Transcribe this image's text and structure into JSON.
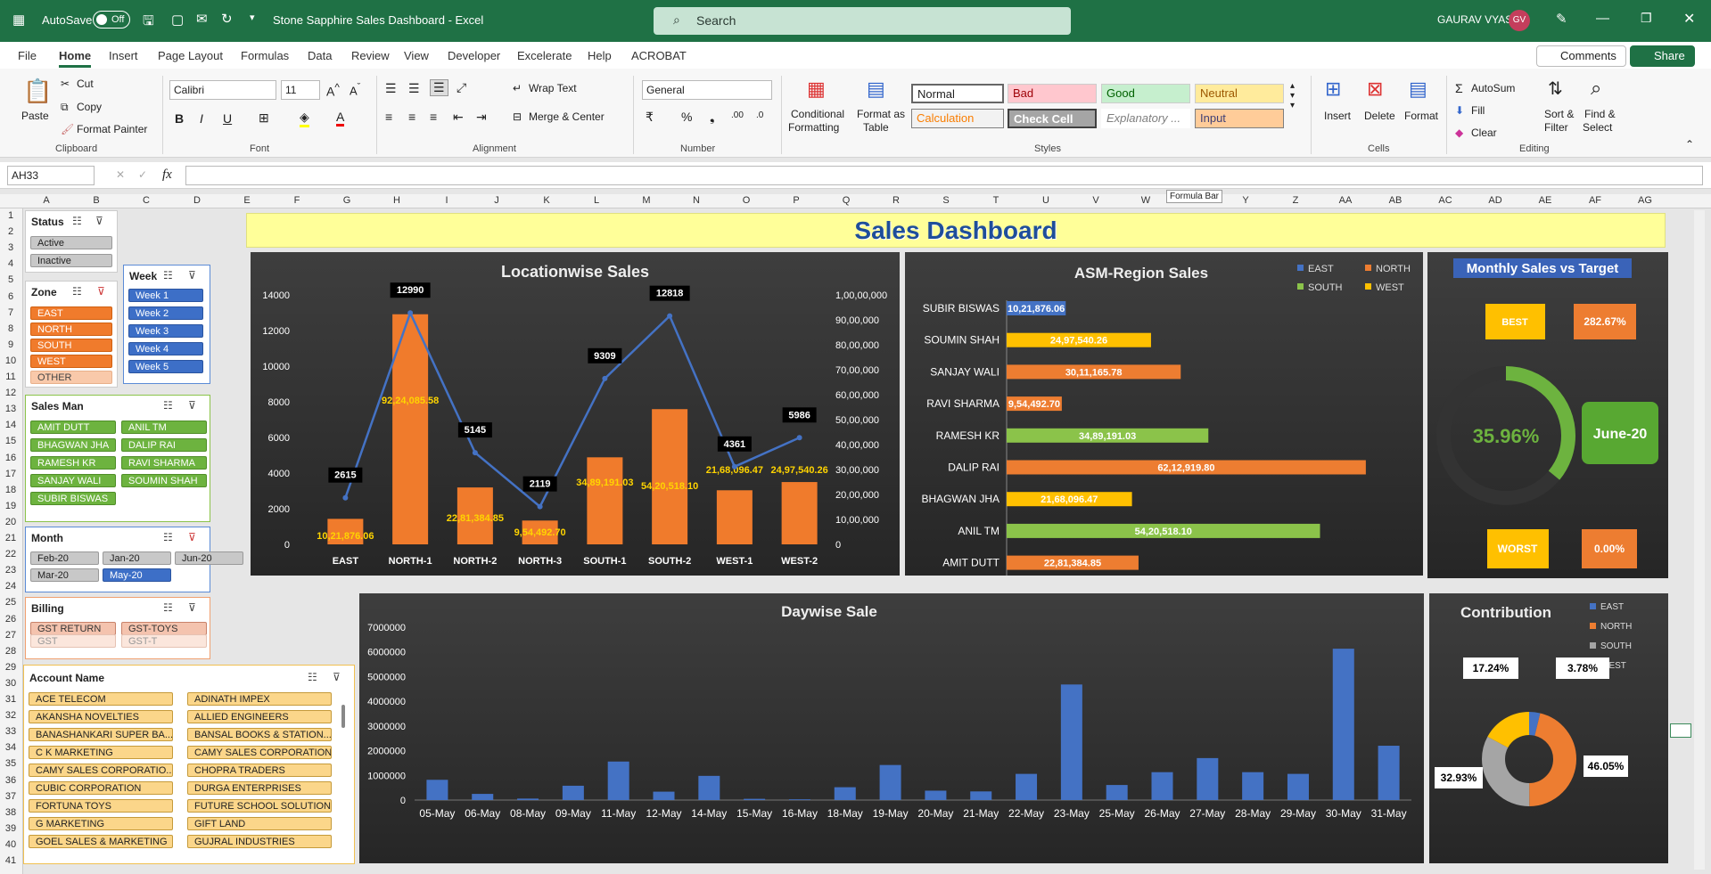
{
  "titlebar": {
    "autosave": "AutoSave",
    "autosave_state": "Off",
    "doc_title": "Stone Sapphire Sales Dashboard  -  Excel",
    "search_placeholder": "Search",
    "user": "GAURAV VYAS",
    "initials": "GV"
  },
  "menu": [
    "File",
    "Home",
    "Insert",
    "Page Layout",
    "Formulas",
    "Data",
    "Review",
    "View",
    "Developer",
    "Excelerate",
    "Help",
    "ACROBAT"
  ],
  "menu_active": "Home",
  "top_buttons": {
    "comments": "Comments",
    "share": "Share"
  },
  "ribbon": {
    "clipboard": {
      "paste": "Paste",
      "cut": "Cut",
      "copy": "Copy",
      "format_painter": "Format Painter",
      "group": "Clipboard"
    },
    "font": {
      "name": "Calibri",
      "size": "11",
      "group": "Font"
    },
    "alignment": {
      "wrap": "Wrap Text",
      "merge": "Merge & Center",
      "group": "Alignment"
    },
    "number": {
      "format": "General",
      "group": "Number"
    },
    "styles": {
      "conditional": "Conditional",
      "conditional2": "Formatting",
      "format_table": "Format as",
      "format_table2": "Table",
      "normal": "Normal",
      "bad": "Bad",
      "good": "Good",
      "neutral": "Neutral",
      "calculation": "Calculation",
      "check": "Check Cell",
      "explanatory": "Explanatory ...",
      "input": "Input",
      "group": "Styles"
    },
    "cells": {
      "insert": "Insert",
      "delete": "Delete",
      "format": "Format",
      "group": "Cells"
    },
    "editing": {
      "autosum": "AutoSum",
      "fill": "Fill",
      "clear": "Clear",
      "sort": "Sort &",
      "sort2": "Filter",
      "find": "Find &",
      "find2": "Select",
      "group": "Editing"
    }
  },
  "formula_bar": {
    "name_box": "AH33",
    "fx": "fx",
    "tooltip": "Formula Bar"
  },
  "columns": [
    "A",
    "B",
    "C",
    "D",
    "E",
    "F",
    "G",
    "H",
    "I",
    "J",
    "K",
    "L",
    "M",
    "N",
    "O",
    "P",
    "Q",
    "R",
    "S",
    "T",
    "U",
    "V",
    "W",
    "X",
    "Y",
    "Z",
    "AA",
    "AB",
    "AC",
    "AD",
    "AE",
    "AF",
    "AG"
  ],
  "rows": [
    "1",
    "2",
    "3",
    "4",
    "5",
    "6",
    "7",
    "8",
    "9",
    "10",
    "11",
    "12",
    "13",
    "14",
    "15",
    "16",
    "17",
    "18",
    "19",
    "20",
    "21",
    "22",
    "23",
    "24",
    "25",
    "26",
    "27",
    "28",
    "29",
    "30",
    "31",
    "32",
    "33",
    "34",
    "35",
    "36",
    "37",
    "38",
    "39",
    "40",
    "41"
  ],
  "dashboard_title": "Sales Dashboard",
  "slicers": {
    "status": {
      "title": "Status",
      "items": [
        "Active",
        "Inactive"
      ]
    },
    "zone": {
      "title": "Zone",
      "items": [
        "EAST",
        "NORTH",
        "SOUTH",
        "WEST",
        "OTHER"
      ]
    },
    "week": {
      "title": "Week",
      "items": [
        "Week 1",
        "Week 2",
        "Week 3",
        "Week 4",
        "Week 5"
      ]
    },
    "salesman": {
      "title": "Sales Man",
      "items": [
        "AMIT DUTT",
        "ANIL TM",
        "BHAGWAN JHA",
        "DALIP RAI",
        "RAMESH KR",
        "RAVI SHARMA",
        "SANJAY WALI",
        "SOUMIN SHAH",
        "SUBIR BISWAS"
      ]
    },
    "month": {
      "title": "Month",
      "items": [
        "Feb-20",
        "Jan-20",
        "Jun-20",
        "Mar-20",
        "May-20"
      ]
    },
    "billing": {
      "title": "Billing",
      "items": [
        "GST RETURN",
        "GST-TOYS",
        "GST",
        "GST-T"
      ]
    },
    "account": {
      "title": "Account Name",
      "items": [
        "ACE TELECOM",
        "ADINATH IMPEX",
        "AKANSHA NOVELTIES",
        "ALLIED ENGINEERS",
        "BANASHANKARI SUPER BA...",
        "BANSAL BOOKS & STATION...",
        "C K MARKETING",
        "CAMY SALES CORPORATION",
        "CAMY SALES CORPORATIO...",
        "CHOPRA TRADERS",
        "CUBIC CORPORATION",
        "DURGA ENTERPRISES",
        "FORTUNA TOYS",
        "FUTURE SCHOOL SOLUTIONS",
        "G MARKETING",
        "GIFT LAND",
        "GOEL SALES & MARKETING",
        "GUJRAL INDUSTRIES"
      ]
    }
  },
  "chart_data": [
    {
      "type": "bar",
      "title": "Locationwise Sales",
      "categories": [
        "EAST",
        "NORTH-1",
        "NORTH-2",
        "NORTH-3",
        "SOUTH-1",
        "SOUTH-2",
        "WEST-1",
        "WEST-2"
      ],
      "series": [
        {
          "values": [
            1021876.06,
            9224085.58,
            2281384.85,
            954492.7,
            3489191.03,
            5420518.1,
            2168096.47,
            2497540.26
          ],
          "labels": [
            "10,21,876.06",
            "92,24,085.58",
            "22,81,384.85",
            "9,54,492.70",
            "34,89,191.03",
            "54,20,518.10",
            "21,68,096.47",
            "24,97,540.26"
          ],
          "axis": "secondary"
        },
        {
          "values": [
            2615,
            12990,
            5145,
            2119,
            9309,
            12818,
            4361,
            5986
          ],
          "axis": "primary",
          "render": "line"
        }
      ],
      "y_ticks": [
        "0",
        "2000",
        "4000",
        "6000",
        "8000",
        "10000",
        "12000",
        "14000"
      ],
      "y2_ticks": [
        "0",
        "10,00,000",
        "20,00,000",
        "30,00,000",
        "40,00,000",
        "50,00,000",
        "60,00,000",
        "70,00,000",
        "80,00,000",
        "90,00,000",
        "1,00,00,000"
      ],
      "ylim": [
        0,
        14000
      ],
      "y2lim": [
        0,
        10000000
      ]
    },
    {
      "type": "bar",
      "orientation": "horizontal",
      "title": "ASM-Region Sales",
      "legend": [
        "EAST",
        "NORTH",
        "SOUTH",
        "WEST"
      ],
      "categories": [
        "SUBIR BISWAS",
        "SOUMIN SHAH",
        "SANJAY WALI",
        "RAVI SHARMA",
        "RAMESH KR",
        "DALIP RAI",
        "BHAGWAN JHA",
        "ANIL TM",
        "AMIT DUTT"
      ],
      "values": [
        1021876.06,
        2497540.26,
        3011165.78,
        954492.7,
        3489191.03,
        6212919.8,
        2168096.47,
        5420518.1,
        2281384.85
      ],
      "labels": [
        "10,21,876.06",
        "24,97,540.26",
        "30,11,165.78",
        "9,54,492.70",
        "34,89,191.03",
        "62,12,919.80",
        "21,68,096.47",
        "54,20,518.10",
        "22,81,384.85"
      ],
      "regions": [
        "EAST",
        "WEST",
        "NORTH",
        "NORTH",
        "SOUTH",
        "NORTH",
        "WEST",
        "SOUTH",
        "NORTH"
      ],
      "colors": {
        "EAST": "#4472c4",
        "NORTH": "#ed7d31",
        "SOUTH": "#8bc34a",
        "WEST": "#ffc000"
      }
    },
    {
      "type": "pie",
      "title": "Monthly Sales vs Target",
      "values": [
        35.96,
        64.04
      ],
      "center_label": "35.96%",
      "month": "June-20",
      "best_label": "BEST",
      "best_value": "282.67%",
      "worst_label": "WORST",
      "worst_value": "0.00%"
    },
    {
      "type": "bar",
      "title": "Daywise Sale",
      "categories": [
        "05-May",
        "06-May",
        "08-May",
        "09-May",
        "11-May",
        "12-May",
        "14-May",
        "15-May",
        "16-May",
        "18-May",
        "19-May",
        "20-May",
        "21-May",
        "22-May",
        "23-May",
        "25-May",
        "26-May",
        "27-May",
        "28-May",
        "29-May",
        "30-May",
        "31-May"
      ],
      "values": [
        820000,
        250000,
        60000,
        580000,
        1560000,
        340000,
        980000,
        50000,
        30000,
        520000,
        1420000,
        380000,
        350000,
        1060000,
        4680000,
        610000,
        1130000,
        1700000,
        1130000,
        1060000,
        6130000,
        2200000
      ],
      "y_ticks": [
        "0",
        "1000000",
        "2000000",
        "3000000",
        "4000000",
        "5000000",
        "6000000",
        "7000000"
      ],
      "ylim": [
        0,
        7000000
      ]
    },
    {
      "type": "pie",
      "title": "Contribution",
      "legend": [
        "EAST",
        "NORTH",
        "SOUTH",
        "WEST"
      ],
      "values": [
        3.78,
        46.05,
        32.93,
        17.24
      ],
      "labels": [
        "3.78%",
        "46.05%",
        "32.93%",
        "17.24%"
      ],
      "colors": [
        "#4472c4",
        "#ed7d31",
        "#a5a5a5",
        "#ffc000"
      ]
    }
  ]
}
